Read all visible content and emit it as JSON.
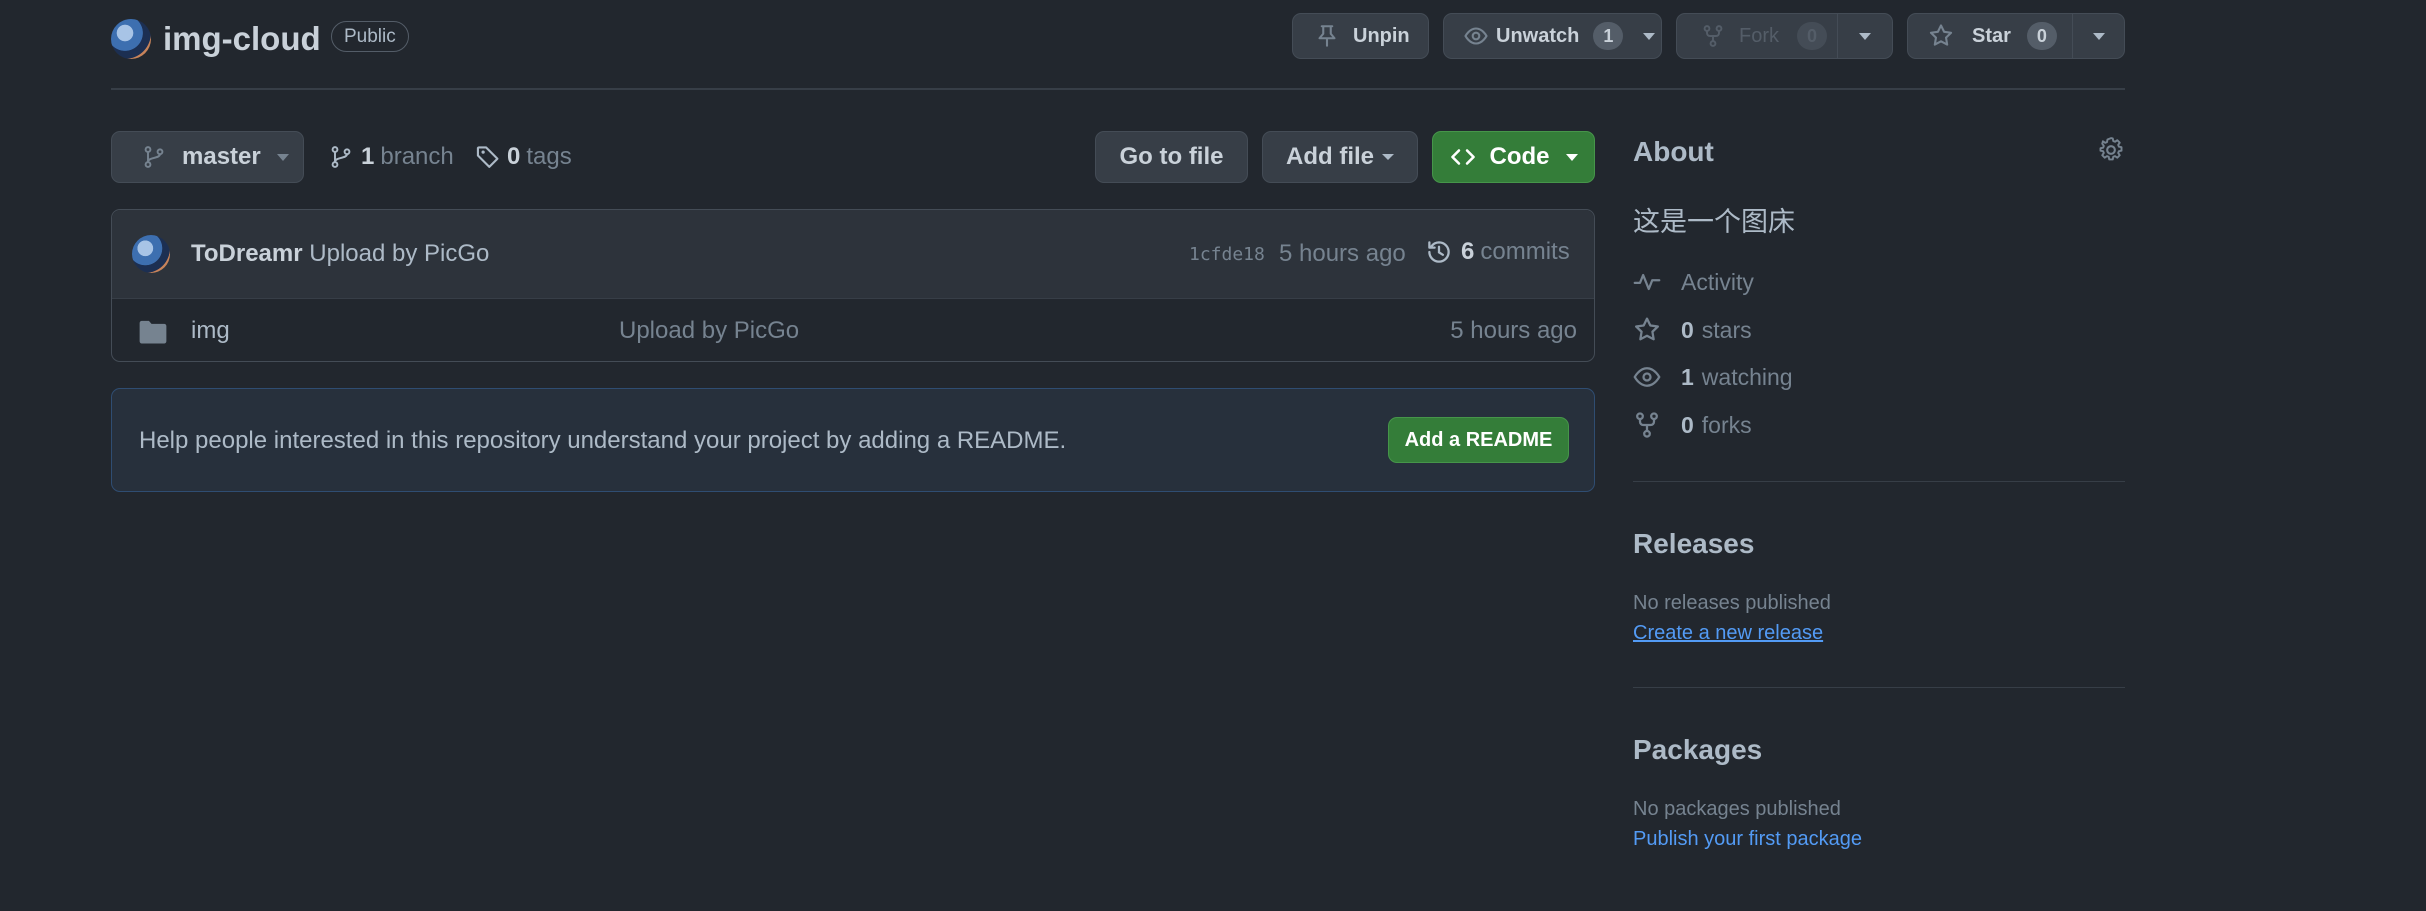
{
  "repo": {
    "name": "img-cloud",
    "visibility": "Public"
  },
  "header_actions": {
    "unpin": "Unpin",
    "unwatch": "Unwatch",
    "watch_count": "1",
    "fork": "Fork",
    "fork_count": "0",
    "star": "Star",
    "star_count": "0"
  },
  "toolbar": {
    "branch": "master",
    "branches_count": "1",
    "branches_label": "branch",
    "tags_count": "0",
    "tags_label": "tags",
    "go_to_file": "Go to file",
    "add_file": "Add file",
    "code": "Code"
  },
  "latest_commit": {
    "author": "ToDreamr",
    "message": "Upload by PicGo",
    "sha": "1cfde18",
    "time": "5 hours ago",
    "commits_count": "6",
    "commits_label": "commits"
  },
  "files": [
    {
      "name": "img",
      "message": "Upload by PicGo",
      "time": "5 hours ago",
      "icon": "folder-icon"
    }
  ],
  "readme_prompt": {
    "text": "Help people interested in this repository understand your project by adding a README.",
    "button": "Add a README"
  },
  "about": {
    "heading": "About",
    "description": "这是一个图床",
    "activity": "Activity",
    "stars_count": "0",
    "stars_label": "stars",
    "watching_count": "1",
    "watching_label": "watching",
    "forks_count": "0",
    "forks_label": "forks"
  },
  "releases": {
    "heading": "Releases",
    "status": "No releases published",
    "link": "Create a new release"
  },
  "packages": {
    "heading": "Packages",
    "status": "No packages published",
    "link": "Publish your first package"
  },
  "colors": {
    "background": "#22272e",
    "green_button": "#347d39",
    "link": "#539bf5",
    "muted_text": "#768390"
  }
}
